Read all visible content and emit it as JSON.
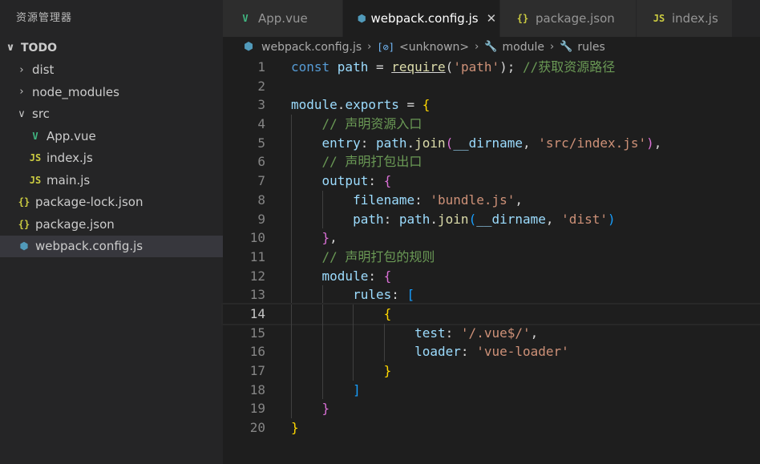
{
  "sidebar": {
    "title": "资源管理器",
    "items": [
      {
        "label": "TODO",
        "icon": "chevron-down-icon",
        "kind": "root",
        "depth": 0,
        "twisty": "∨",
        "file_icon": ""
      },
      {
        "label": "dist",
        "icon": "chevron-right-icon",
        "kind": "folder",
        "depth": 1,
        "twisty": "›",
        "file_icon": ""
      },
      {
        "label": "node_modules",
        "icon": "chevron-right-icon",
        "kind": "folder",
        "depth": 1,
        "twisty": "›",
        "file_icon": ""
      },
      {
        "label": "src",
        "icon": "chevron-down-icon",
        "kind": "folder",
        "depth": 1,
        "twisty": "∨",
        "file_icon": ""
      },
      {
        "label": "App.vue",
        "icon": "vue-file-icon",
        "kind": "vue",
        "depth": 2,
        "twisty": "",
        "file_icon": "V"
      },
      {
        "label": "index.js",
        "icon": "js-file-icon",
        "kind": "js",
        "depth": 2,
        "twisty": "",
        "file_icon": "JS"
      },
      {
        "label": "main.js",
        "icon": "js-file-icon",
        "kind": "js",
        "depth": 2,
        "twisty": "",
        "file_icon": "JS"
      },
      {
        "label": "package-lock.json",
        "icon": "json-file-icon",
        "kind": "json",
        "depth": 1,
        "twisty": "",
        "file_icon": "{}"
      },
      {
        "label": "package.json",
        "icon": "json-file-icon",
        "kind": "json",
        "depth": 1,
        "twisty": "",
        "file_icon": "{}"
      },
      {
        "label": "webpack.config.js",
        "icon": "webpack-file-icon",
        "kind": "webpack",
        "depth": 1,
        "twisty": "",
        "file_icon": "⬢",
        "selected": true
      }
    ]
  },
  "tabs": [
    {
      "label": "App.vue",
      "icon": "vue-file-icon",
      "kind": "vue",
      "file_icon": "V",
      "active": false
    },
    {
      "label": "webpack.config.js",
      "icon": "webpack-file-icon",
      "kind": "webpack",
      "file_icon": "⬢",
      "active": true,
      "close": "✕"
    },
    {
      "label": "package.json",
      "icon": "json-file-icon",
      "kind": "json",
      "file_icon": "{}",
      "active": false
    },
    {
      "label": "index.js",
      "icon": "js-file-icon",
      "kind": "js",
      "file_icon": "JS",
      "active": false
    }
  ],
  "breadcrumb": {
    "file": "webpack.config.js",
    "file_icon": "⬢",
    "unknown": "<unknown>",
    "unknown_icon": "[⊘]",
    "module": "module",
    "rules": "rules",
    "wrench": "🔧",
    "sep": "›"
  },
  "editor": {
    "current_line": 14,
    "lines": [
      {
        "n": "1",
        "tokens": [
          [
            "kw",
            "const "
          ],
          [
            "var",
            "path"
          ],
          [
            "pn",
            " = "
          ],
          [
            "fn squiggle",
            "require"
          ],
          [
            "pn",
            "("
          ],
          [
            "str",
            "'path'"
          ],
          [
            "pn",
            ");"
          ],
          [
            "cm",
            " //获取资源路径"
          ]
        ]
      },
      {
        "n": "2",
        "tokens": []
      },
      {
        "n": "3",
        "tokens": [
          [
            "var",
            "module"
          ],
          [
            "pn",
            "."
          ],
          [
            "var",
            "exports"
          ],
          [
            "pn",
            " = "
          ],
          [
            "br",
            "{"
          ]
        ]
      },
      {
        "n": "4",
        "tokens": [
          [
            "pn",
            "    "
          ],
          [
            "cm",
            "// 声明资源入口"
          ]
        ]
      },
      {
        "n": "5",
        "tokens": [
          [
            "pn",
            "    "
          ],
          [
            "var",
            "entry"
          ],
          [
            "pn",
            ": "
          ],
          [
            "var",
            "path"
          ],
          [
            "pn",
            "."
          ],
          [
            "fn",
            "join"
          ],
          [
            "br2",
            "("
          ],
          [
            "var",
            "__dirname"
          ],
          [
            "pn",
            ", "
          ],
          [
            "str",
            "'src/index.js'"
          ],
          [
            "br2",
            ")"
          ],
          [
            "pn",
            ","
          ]
        ]
      },
      {
        "n": "6",
        "tokens": [
          [
            "pn",
            "    "
          ],
          [
            "cm",
            "// 声明打包出口"
          ]
        ]
      },
      {
        "n": "7",
        "tokens": [
          [
            "pn",
            "    "
          ],
          [
            "var",
            "output"
          ],
          [
            "pn",
            ": "
          ],
          [
            "br2",
            "{"
          ]
        ]
      },
      {
        "n": "8",
        "tokens": [
          [
            "pn",
            "        "
          ],
          [
            "var",
            "filename"
          ],
          [
            "pn",
            ": "
          ],
          [
            "str",
            "'bundle.js'"
          ],
          [
            "pn",
            ","
          ]
        ]
      },
      {
        "n": "9",
        "tokens": [
          [
            "pn",
            "        "
          ],
          [
            "var",
            "path"
          ],
          [
            "pn",
            ": "
          ],
          [
            "var",
            "path"
          ],
          [
            "pn",
            "."
          ],
          [
            "fn",
            "join"
          ],
          [
            "br3",
            "("
          ],
          [
            "var",
            "__dirname"
          ],
          [
            "pn",
            ", "
          ],
          [
            "str",
            "'dist'"
          ],
          [
            "br3",
            ")"
          ]
        ]
      },
      {
        "n": "10",
        "tokens": [
          [
            "pn",
            "    "
          ],
          [
            "br2",
            "}"
          ],
          [
            "pn",
            ","
          ]
        ]
      },
      {
        "n": "11",
        "tokens": [
          [
            "pn",
            "    "
          ],
          [
            "cm",
            "// 声明打包的规则"
          ]
        ]
      },
      {
        "n": "12",
        "tokens": [
          [
            "pn",
            "    "
          ],
          [
            "var",
            "module"
          ],
          [
            "pn",
            ": "
          ],
          [
            "br2",
            "{"
          ]
        ]
      },
      {
        "n": "13",
        "tokens": [
          [
            "pn",
            "        "
          ],
          [
            "var",
            "rules"
          ],
          [
            "pn",
            ": "
          ],
          [
            "br3",
            "["
          ]
        ]
      },
      {
        "n": "14",
        "tokens": [
          [
            "pn",
            "            "
          ],
          [
            "br",
            "{"
          ]
        ]
      },
      {
        "n": "15",
        "tokens": [
          [
            "pn",
            "                "
          ],
          [
            "var",
            "test"
          ],
          [
            "pn",
            ": "
          ],
          [
            "str",
            "'/.vue$/'"
          ],
          [
            "pn",
            ","
          ]
        ]
      },
      {
        "n": "16",
        "tokens": [
          [
            "pn",
            "                "
          ],
          [
            "var",
            "loader"
          ],
          [
            "pn",
            ": "
          ],
          [
            "str",
            "'vue-loader'"
          ]
        ]
      },
      {
        "n": "17",
        "tokens": [
          [
            "pn",
            "            "
          ],
          [
            "br",
            "}"
          ]
        ]
      },
      {
        "n": "18",
        "tokens": [
          [
            "pn",
            "        "
          ],
          [
            "br3",
            "]"
          ]
        ]
      },
      {
        "n": "19",
        "tokens": [
          [
            "pn",
            "    "
          ],
          [
            "br2",
            "}"
          ]
        ]
      },
      {
        "n": "20",
        "tokens": [
          [
            "br",
            "}"
          ]
        ]
      }
    ]
  }
}
